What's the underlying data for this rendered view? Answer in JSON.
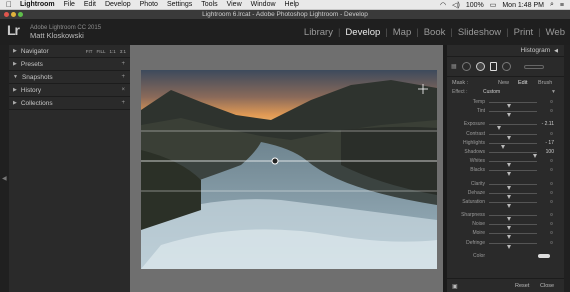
{
  "menubar": {
    "apple": "",
    "app_name": "Lightroom",
    "items": [
      "File",
      "Edit",
      "Develop",
      "Photo",
      "Settings",
      "Tools",
      "View",
      "Window",
      "Help"
    ],
    "battery": "100%",
    "clock": "Mon 1:48 PM"
  },
  "window": {
    "title": "Lightroom 6.lrcat - Adobe Photoshop Lightroom - Develop"
  },
  "identity": {
    "logo": "Lr",
    "product": "Adobe Lightroom CC 2015",
    "user": "Matt Kloskowski"
  },
  "modules": [
    "Library",
    "Develop",
    "Map",
    "Book",
    "Slideshow",
    "Print",
    "Web"
  ],
  "active_module": "Develop",
  "left_panels": [
    {
      "label": "Navigator",
      "tri": "▶",
      "right": ""
    },
    {
      "label": "Presets",
      "tri": "▶",
      "right": "+"
    },
    {
      "label": "Snapshots",
      "tri": "▼",
      "right": "+"
    },
    {
      "label": "History",
      "tri": "▶",
      "right": "×"
    },
    {
      "label": "Collections",
      "tri": "▶",
      "right": "+"
    }
  ],
  "navigator_tools": [
    "FIT",
    "FILL",
    "1:1",
    "3:1"
  ],
  "right_panel": {
    "histogram_label": "Histogram",
    "mask_label": "Mask :",
    "mask_new": "New",
    "mask_edit": "Edit",
    "mask_brush": "Brush",
    "effect_label": "Effect :",
    "effect_value": "Custom",
    "sliders": [
      {
        "label": "Temp",
        "value": ""
      },
      {
        "label": "Tint",
        "value": ""
      },
      {
        "label": "",
        "value": ""
      },
      {
        "label": "Exposure",
        "value": "- 2.11"
      },
      {
        "label": "Contrast",
        "value": ""
      },
      {
        "label": "Highlights",
        "value": "- 17"
      },
      {
        "label": "Shadows",
        "value": "100"
      },
      {
        "label": "Whites",
        "value": ""
      },
      {
        "label": "Blacks",
        "value": ""
      },
      {
        "label": "",
        "value": ""
      },
      {
        "label": "Clarity",
        "value": ""
      },
      {
        "label": "Dehaze",
        "value": ""
      },
      {
        "label": "Saturation",
        "value": ""
      },
      {
        "label": "",
        "value": ""
      },
      {
        "label": "Sharpness",
        "value": ""
      },
      {
        "label": "Noise",
        "value": ""
      },
      {
        "label": "Moire",
        "value": ""
      },
      {
        "label": "Defringe",
        "value": ""
      },
      {
        "label": "",
        "value": ""
      },
      {
        "label": "Color",
        "value": ""
      }
    ],
    "reset_label": "Reset",
    "close_label": "Close"
  },
  "colors": {
    "menubar_bg": "#e9e9e9",
    "panel_bg": "#2a2a2a",
    "center_bg": "#6f6f6f",
    "active_text": "#e8e8e8"
  }
}
